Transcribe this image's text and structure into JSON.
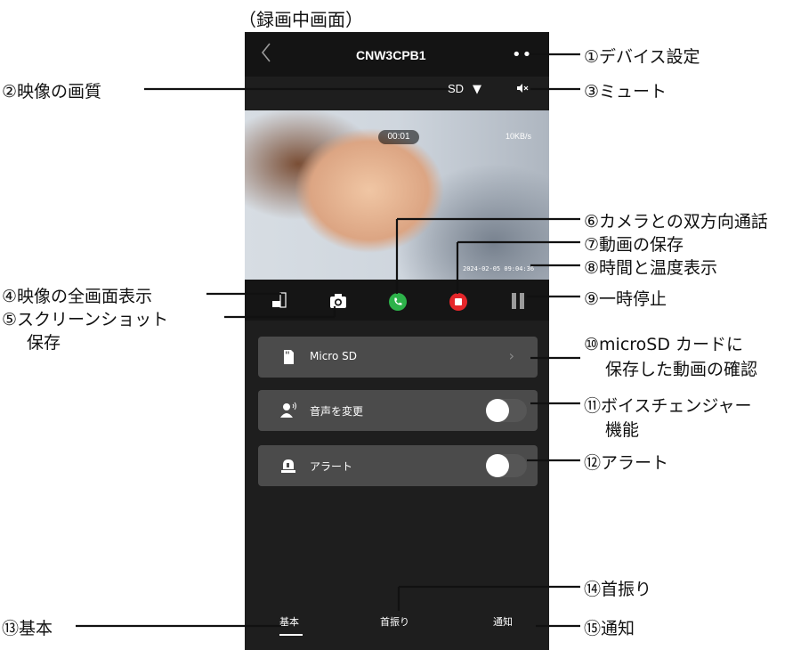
{
  "caption": "（録画中画面）",
  "app": {
    "back_icon": "chevron-left-icon",
    "title": "CNW3CPB1",
    "more_icon": "more-dots-icon",
    "quality": "SD",
    "quality_caret": "▼",
    "mute_icon": "speaker-mute-icon"
  },
  "video": {
    "elapsed": "00:01",
    "bitrate": "10KB/s",
    "timestamp": "2024-02-05 09:04:36"
  },
  "controls": [
    {
      "name": "fullscreen-icon"
    },
    {
      "name": "camera-icon"
    },
    {
      "name": "call-icon",
      "color": "#2db24a"
    },
    {
      "name": "record-stop-icon",
      "color": "#e5262a"
    },
    {
      "name": "pause-icon"
    }
  ],
  "menu": {
    "sd_label": "Micro SD",
    "voice_label": "音声を変更",
    "alert_label": "アラート",
    "voice_toggle": false,
    "alert_toggle": false
  },
  "bottom_nav": {
    "tab_basic": "基本",
    "tab_pan": "首振り",
    "tab_notify": "通知"
  },
  "annotations": {
    "a1": "①デバイス設定",
    "a2": "②映像の画質",
    "a3": "③ミュート",
    "a4": "④映像の全画面表示",
    "a5_line1": "⑤スクリーンショット",
    "a5_line2": "保存",
    "a6": "⑥カメラとの双方向通話",
    "a7": "⑦動画の保存",
    "a8": "⑧時間と温度表示",
    "a9": "⑨一時停止",
    "a10_line1": "⑩microSD カードに",
    "a10_line2": "保存した動画の確認",
    "a11_line1": "⑪ボイスチェンジャー",
    "a11_line2": "機能",
    "a12": "⑫アラート",
    "a13": "⑬基本",
    "a14": "⑭首振り",
    "a15": "⑮通知"
  }
}
